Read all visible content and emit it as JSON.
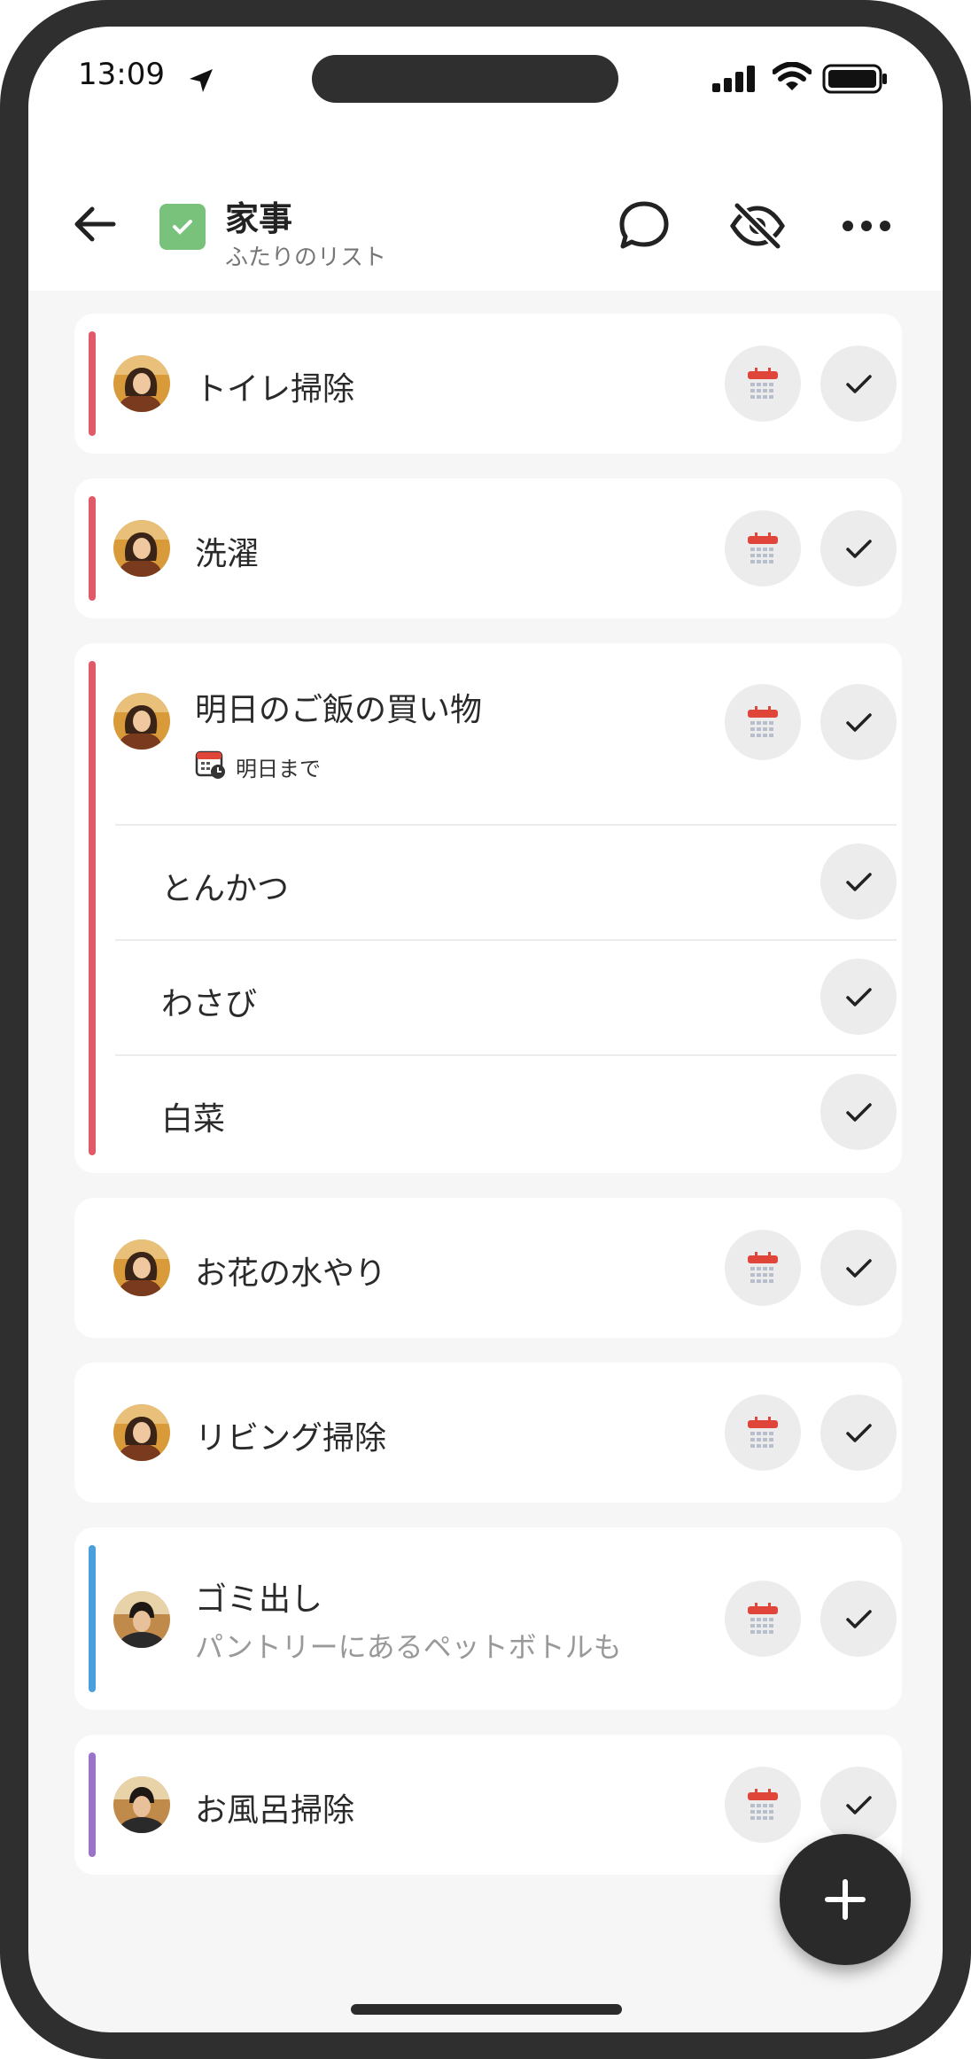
{
  "status_bar": {
    "time": "13:09"
  },
  "header": {
    "title": "家事",
    "subtitle": "ふたりのリスト"
  },
  "colors": {
    "red": "#e15a6a",
    "blue": "#4a9fdc",
    "purple": "#9b74c9",
    "green": "#79c27c"
  },
  "tasks": [
    {
      "title": "トイレ掃除",
      "assignee": "her",
      "bar_color": "red"
    },
    {
      "title": "洗濯",
      "assignee": "her",
      "bar_color": "red"
    },
    {
      "title": "明日のご飯の買い物",
      "assignee": "her",
      "bar_color": "red",
      "due": "明日まで",
      "subtasks": [
        "とんかつ",
        "わさび",
        "白菜"
      ]
    },
    {
      "title": "お花の水やり",
      "assignee": "her"
    },
    {
      "title": "リビング掃除",
      "assignee": "her"
    },
    {
      "title": "ゴミ出し",
      "assignee": "him",
      "bar_color": "blue",
      "note": "パントリーにあるペットボトルも"
    },
    {
      "title": "お風呂掃除",
      "assignee": "him",
      "bar_color": "purple"
    }
  ],
  "icons": [
    "location-arrow-icon",
    "signal-icon",
    "wifi-icon",
    "battery-icon",
    "back-arrow-icon",
    "list-check-icon",
    "chat-bubble-icon",
    "eye-off-icon",
    "more-dots-icon",
    "calendar-icon",
    "check-icon",
    "plus-icon"
  ]
}
